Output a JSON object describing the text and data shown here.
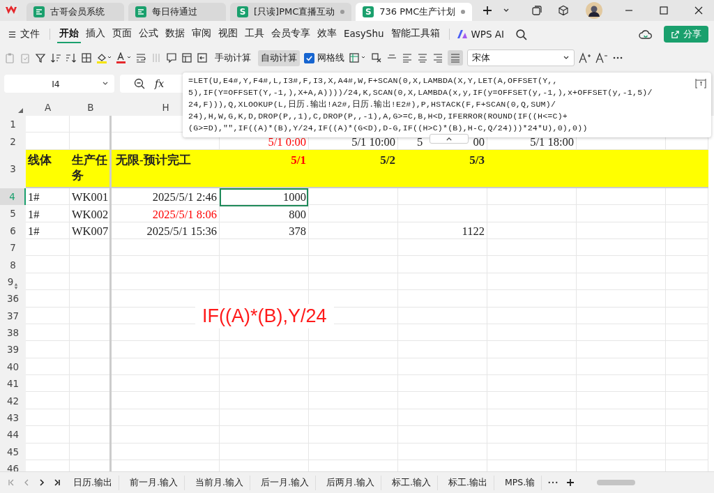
{
  "browser_tabs": [
    {
      "label": "古哥会员系统",
      "kind": "app",
      "selected": false,
      "modified": false
    },
    {
      "label": "每日待通过",
      "kind": "app",
      "selected": false,
      "modified": false
    },
    {
      "label": "[只读]PMC直播互动",
      "kind": "sheet",
      "badge": "S",
      "selected": false,
      "modified": true
    },
    {
      "label": "736 PMC生产计划",
      "kind": "sheet",
      "badge": "S",
      "selected": true,
      "modified": true
    }
  ],
  "menu": {
    "file": "文件",
    "items": [
      {
        "label": "开始",
        "selected": true
      },
      {
        "label": "插入",
        "selected": false
      },
      {
        "label": "页面",
        "selected": false
      },
      {
        "label": "公式",
        "selected": false
      },
      {
        "label": "数据",
        "selected": false
      },
      {
        "label": "审阅",
        "selected": false
      },
      {
        "label": "视图",
        "selected": false
      },
      {
        "label": "工具",
        "selected": false
      },
      {
        "label": "会员专享",
        "selected": false
      },
      {
        "label": "效率",
        "selected": false
      },
      {
        "label": "EasyShu",
        "selected": false
      },
      {
        "label": "智能工具箱",
        "selected": false
      }
    ],
    "ai": "WPS AI",
    "share": "分享"
  },
  "toolbar": {
    "calc_buttons": [
      {
        "label": "手动计算",
        "selected": false
      },
      {
        "label": "自动计算",
        "selected": true
      }
    ],
    "gridlines": {
      "label": "网格线",
      "checked": true
    },
    "font": "宋体"
  },
  "formula_bar": {
    "name_box": "I4",
    "fx": "fx",
    "formula_lines": [
      "=LET(U,E4#,Y,F4#,L,I3#,F,I3,X,A4#,W,F+SCAN(0,X,LAMBDA(X,Y,LET(A,OFFSET(Y,,",
      "5),IF(Y=OFFSET(Y,-1,),X+A,A))))/24,K,SCAN(0,X,LAMBDA(x,y,IF(y=OFFSET(y,-1,),x+OFFSET(y,-1,5)/",
      "24,F))),Q,XLOOKUP(L,日历.输出!A2#,日历.输出!E2#),P,HSTACK(F,F+SCAN(0,Q,SUM)/",
      "24),H,W,G,K,D,DROP(P,,1),C,DROP(P,,-1),A,G>=C,B,H<D,IFERROR(ROUND(IF((H<=C)+",
      "(G>=D),\"\",IF((A)*(B),Y/24,IF((A)*(G<D),D-G,IF((H>C)*(B),H-C,Q/24)))*24*U),0),0))"
    ]
  },
  "grid": {
    "columns": [
      "A",
      "B",
      "H"
    ],
    "rows": [
      {
        "number": "1",
        "kind": "plain",
        "selected": false,
        "cells": []
      },
      {
        "number": "2",
        "kind": "plain",
        "selected": false,
        "cells": [
          "",
          "",
          "",
          {
            "text": "5/1 0:00",
            "color": "#ff0000"
          },
          "5/1 10:00",
          {
            "fragments": [
              "5",
              "00"
            ]
          },
          "5/1 18:00"
        ]
      },
      {
        "number": "3",
        "kind": "header",
        "selected": false,
        "cells": [
          "线体",
          "生产任务",
          "无限-预计完工",
          {
            "text": "5/1",
            "color": "#ff0000"
          },
          "5/2",
          "5/3"
        ]
      },
      {
        "number": "4",
        "kind": "data",
        "selected": true,
        "cells": [
          "1#",
          "WK001",
          "2025/5/1 2:46",
          {
            "text": "1000",
            "selected": true
          }
        ]
      },
      {
        "number": "5",
        "kind": "data",
        "selected": false,
        "cells": [
          "1#",
          "WK002",
          {
            "text": "2025/5/1 8:06",
            "color": "#ff0000"
          },
          "800"
        ]
      },
      {
        "number": "6",
        "kind": "data",
        "selected": false,
        "cells": [
          "1#",
          "WK007",
          "2025/5/1 15:36",
          "378",
          "",
          "1122"
        ]
      },
      {
        "number": "7",
        "kind": "plain",
        "selected": false,
        "cells": []
      },
      {
        "number": "8",
        "kind": "plain",
        "selected": false,
        "cells": []
      },
      {
        "number": "9",
        "kind": "plain",
        "selected": false,
        "cells": [],
        "hidden_after": true
      },
      {
        "number": "36",
        "kind": "plain",
        "selected": false,
        "cells": []
      },
      {
        "number": "37",
        "kind": "plain",
        "selected": false,
        "cells": []
      },
      {
        "number": "38",
        "kind": "plain",
        "selected": false,
        "cells": []
      },
      {
        "number": "39",
        "kind": "plain",
        "selected": false,
        "cells": []
      },
      {
        "number": "40",
        "kind": "plain",
        "selected": false,
        "cells": []
      },
      {
        "number": "41",
        "kind": "plain",
        "selected": false,
        "cells": []
      },
      {
        "number": "42",
        "kind": "plain",
        "selected": false,
        "cells": []
      },
      {
        "number": "43",
        "kind": "plain",
        "selected": false,
        "cells": []
      },
      {
        "number": "44",
        "kind": "plain",
        "selected": false,
        "cells": []
      },
      {
        "number": "45",
        "kind": "plain",
        "selected": false,
        "cells": []
      },
      {
        "number": "46",
        "kind": "plain",
        "selected": false,
        "cells": []
      }
    ]
  },
  "annotation": {
    "text": "IF((A)*(B),Y/24"
  },
  "sheet_tabs": [
    "日历.输出",
    "前一月.输入",
    "当前月.输入",
    "后一月.输入",
    "后两月.输入",
    "标工.输入",
    "标工.输出",
    "MPS.输"
  ]
}
